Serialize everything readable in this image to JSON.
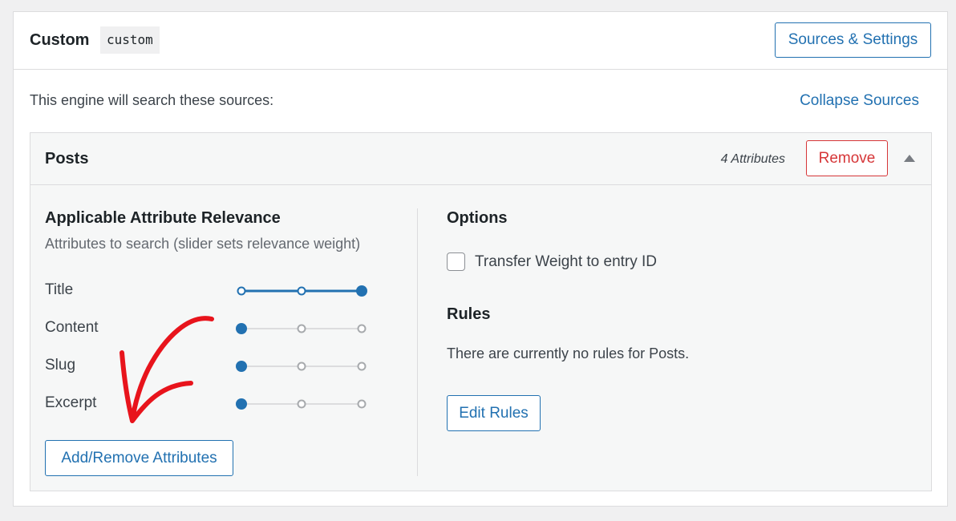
{
  "engine": {
    "name": "Custom",
    "slug": "custom",
    "sources_button": "Sources & Settings",
    "intro_text": "This engine will search these sources:",
    "collapse_link": "Collapse Sources"
  },
  "source": {
    "title": "Posts",
    "attribute_count": "4 Attributes",
    "remove_button": "Remove",
    "relevance": {
      "title": "Applicable Attribute Relevance",
      "subtitle": "Attributes to search (slider sets relevance weight)",
      "attributes": [
        {
          "label": "Title",
          "level": 3
        },
        {
          "label": "Content",
          "level": 1
        },
        {
          "label": "Slug",
          "level": 1
        },
        {
          "label": "Excerpt",
          "level": 1
        }
      ],
      "slider_levels": 3,
      "add_remove_button": "Add/Remove Attributes"
    },
    "options": {
      "title": "Options",
      "checkbox_label": "Transfer Weight to entry ID",
      "checkbox_checked": false
    },
    "rules": {
      "title": "Rules",
      "empty_text": "There are currently no rules for Posts.",
      "edit_button": "Edit Rules"
    }
  },
  "colors": {
    "accent": "#2271b1",
    "danger": "#d63638",
    "slider_inactive": "#a7aaad",
    "annotation": "#e8141c"
  },
  "annotation": {
    "type": "hand-drawn-arrow",
    "points_to": "add-remove-attributes-button"
  }
}
